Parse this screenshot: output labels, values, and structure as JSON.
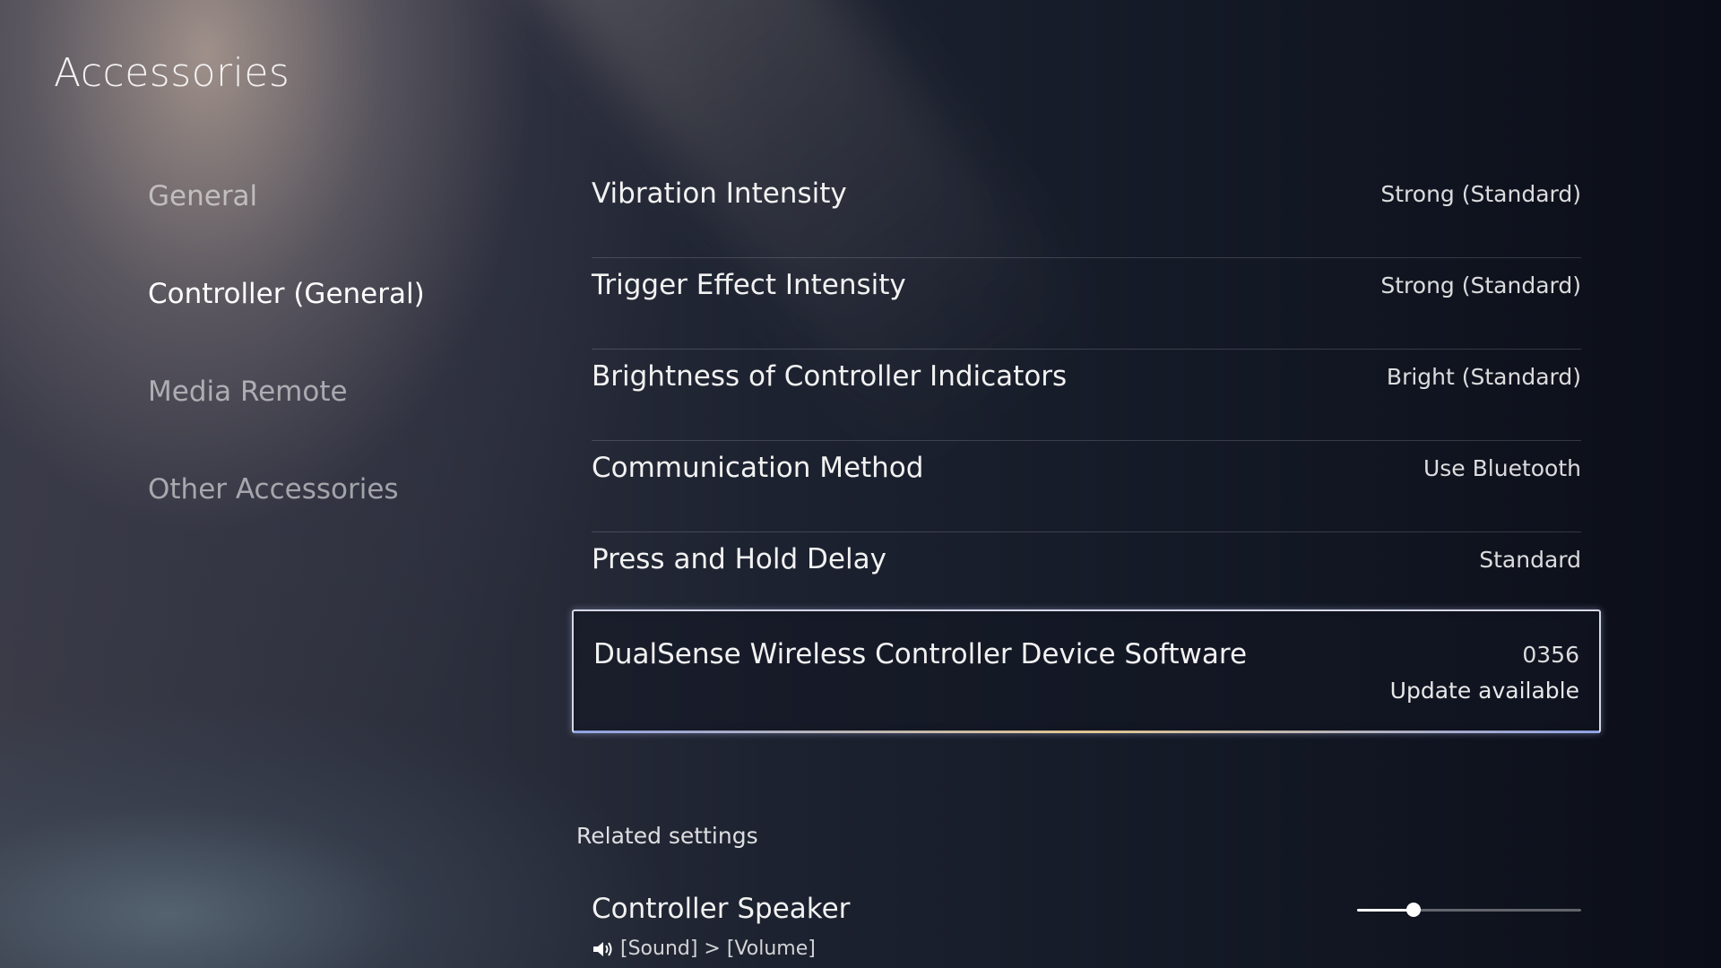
{
  "header": {
    "title": "Accessories"
  },
  "sidebar": {
    "active_index": 1,
    "items": [
      {
        "label": "General"
      },
      {
        "label": "Controller (General)"
      },
      {
        "label": "Media Remote"
      },
      {
        "label": "Other Accessories"
      }
    ]
  },
  "settings": {
    "items": [
      {
        "label": "Vibration Intensity",
        "value": "Strong (Standard)"
      },
      {
        "label": "Trigger Effect Intensity",
        "value": "Strong (Standard)"
      },
      {
        "label": "Brightness of Controller Indicators",
        "value": "Bright (Standard)"
      },
      {
        "label": "Communication Method",
        "value": "Use Bluetooth"
      },
      {
        "label": "Press and Hold Delay",
        "value": "Standard"
      }
    ],
    "selected_item": {
      "label": "DualSense Wireless Controller Device Software",
      "value": "0356",
      "status": "Update available"
    }
  },
  "related": {
    "heading": "Related settings",
    "item": {
      "label": "Controller Speaker",
      "icon": "speaker-icon",
      "path": "[Sound] > [Volume]",
      "slider_fraction": 0.25
    }
  },
  "colors": {
    "background": "#0d1019",
    "text": "#ffffff",
    "inactive_text": "#8c8a90",
    "selection_border": "#e1e1f0"
  }
}
